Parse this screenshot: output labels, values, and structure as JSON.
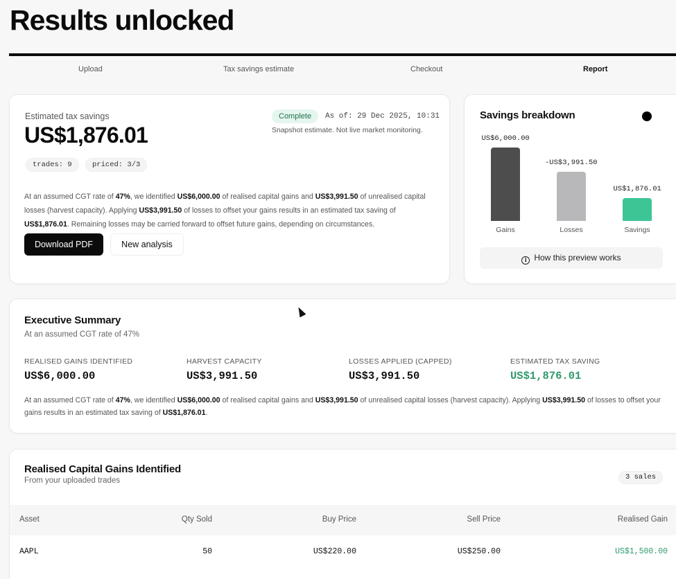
{
  "page": {
    "title": "Results unlocked"
  },
  "steps": [
    "Upload",
    "Tax savings estimate",
    "Checkout",
    "Report"
  ],
  "savings": {
    "label": "Estimated tax savings",
    "amount": "US$1,876.01",
    "status": "Complete",
    "as_of": "As of: 29 Dec 2025, 10:31",
    "snapshot_note": "Snapshot estimate. Not live market monitoring.",
    "chips": [
      "trades: 9",
      "priced: 3/3"
    ],
    "body": {
      "t1": "At an assumed CGT rate of ",
      "rate": "47%",
      "t2": ", we identified ",
      "gains": "US$6,000.00",
      "t3": " of realised capital gains and ",
      "losses": "US$3,991.50",
      "t4": " of unrealised capital losses (harvest capacity). Applying ",
      "applied": "US$3,991.50",
      "t5": " of losses to offset your gains results in an estimated tax saving of ",
      "saving": "US$1,876.01",
      "t6": ". Remaining losses may be carried forward to offset future gains, depending on circumstances."
    },
    "download_label": "Download PDF",
    "new_analysis_label": "New analysis"
  },
  "breakdown": {
    "title": "Savings breakdown",
    "preview_label": "How this preview works",
    "toggle_on": true
  },
  "chart_data": {
    "type": "bar",
    "categories": [
      "Gains",
      "Losses",
      "Savings"
    ],
    "values": [
      6000.0,
      -3991.5,
      1876.01
    ],
    "value_labels": [
      "US$6,000.00",
      "-US$3,991.50",
      "US$1,876.01"
    ],
    "colors": [
      "#4d4d4d",
      "#b8b8bb",
      "#3ec596"
    ],
    "ylim": [
      0,
      6000
    ]
  },
  "executive": {
    "title": "Executive Summary",
    "subtitle": "At an assumed CGT rate of 47%",
    "stats": [
      {
        "label": "REALISED GAINS IDENTIFIED",
        "value": "US$6,000.00"
      },
      {
        "label": "HARVEST CAPACITY",
        "value": "US$3,991.50"
      },
      {
        "label": "LOSSES APPLIED (CAPPED)",
        "value": "US$3,991.50"
      },
      {
        "label": "ESTIMATED TAX SAVING",
        "value": "US$1,876.01"
      }
    ],
    "body": {
      "t1": "At an assumed CGT rate of ",
      "rate": "47%",
      "t2": ", we identified ",
      "gains": "US$6,000.00",
      "t3": " of realised capital gains and ",
      "losses": "US$3,991.50",
      "t4": " of unrealised capital losses (harvest capacity). Applying ",
      "applied": "US$3,991.50",
      "t5": " of losses to offset your gains results in an estimated tax saving of ",
      "saving": "US$1,876.01",
      "t6": "."
    }
  },
  "gains_table": {
    "title": "Realised Capital Gains Identified",
    "subtitle": "From your uploaded trades",
    "count_badge": "3 sales",
    "columns": [
      "Asset",
      "Qty Sold",
      "Buy Price",
      "Sell Price",
      "Realised Gain"
    ],
    "rows": [
      [
        "AAPL",
        "50",
        "US$220.00",
        "US$250.00",
        "US$1,500.00"
      ]
    ]
  }
}
